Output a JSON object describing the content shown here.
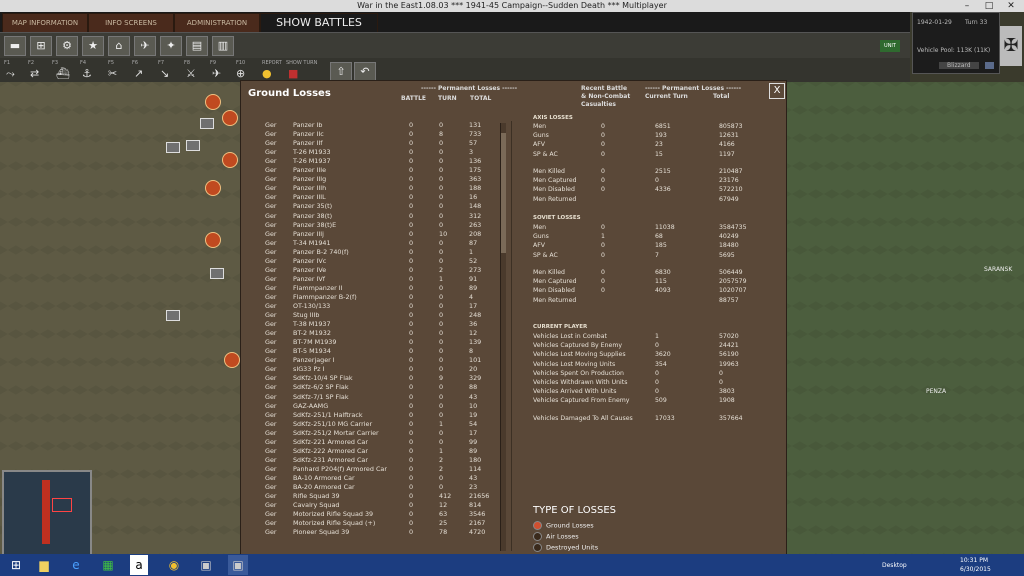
{
  "window": {
    "title": "War in the East1.08.03   ***   1941-45 Campaign--Sudden Death   ***   Multiplayer",
    "controls": [
      "–",
      "□",
      "✕"
    ]
  },
  "tabs": [
    {
      "label": "MAP INFORMATION"
    },
    {
      "label": "INFO SCREENS"
    },
    {
      "label": "ADMINISTRATION"
    },
    {
      "label": "SHOW BATTLES"
    }
  ],
  "infobox": {
    "date": "1942-01-29",
    "turn": "Turn 33",
    "vehicle_pool": "Vehicle Pool: 113K (11K)",
    "weather": "Blizzard",
    "button": "UNIT"
  },
  "fkeys": [
    "F1",
    "F2",
    "F3",
    "F4",
    "F5",
    "F6",
    "F7",
    "F8",
    "F9",
    "F10",
    "REPORT",
    "SHOW TURN"
  ],
  "map_labels": [
    {
      "text": "SARANSK"
    },
    {
      "text": "PENZA"
    }
  ],
  "panel": {
    "title": "Ground Losses",
    "close": "X",
    "headers": {
      "perm": "------ Permanent Losses ------",
      "battle": "BATTLE",
      "turn": "TURN",
      "total": "TOTAL",
      "recent": "Recent Battle",
      "noncombat1": "& Non-Combat",
      "noncombat2": "Casualties",
      "perm2": "------ Permanent Losses ------",
      "current": "Current Turn",
      "total2": "Total"
    },
    "rows": [
      [
        "Ger",
        "Panzer Ib",
        "0",
        "0",
        "131"
      ],
      [
        "Ger",
        "Panzer IIc",
        "0",
        "8",
        "733"
      ],
      [
        "Ger",
        "Panzer IIf",
        "0",
        "0",
        "57"
      ],
      [
        "Ger",
        "T-26 M1933",
        "0",
        "0",
        "3"
      ],
      [
        "Ger",
        "T-26 M1937",
        "0",
        "0",
        "136"
      ],
      [
        "Ger",
        "Panzer IIIe",
        "0",
        "0",
        "175"
      ],
      [
        "Ger",
        "Panzer IIIg",
        "0",
        "0",
        "363"
      ],
      [
        "Ger",
        "Panzer IIIh",
        "0",
        "0",
        "188"
      ],
      [
        "Ger",
        "Panzer IIIL",
        "0",
        "0",
        "16"
      ],
      [
        "Ger",
        "Panzer 35(t)",
        "0",
        "0",
        "148"
      ],
      [
        "Ger",
        "Panzer 38(t)",
        "0",
        "0",
        "312"
      ],
      [
        "Ger",
        "Panzer 38(t)E",
        "0",
        "0",
        "263"
      ],
      [
        "Ger",
        "Panzer IIIj",
        "0",
        "10",
        "208"
      ],
      [
        "Ger",
        "T-34 M1941",
        "0",
        "0",
        "87"
      ],
      [
        "Ger",
        "Panzer B-2 740(f)",
        "0",
        "0",
        "1"
      ],
      [
        "Ger",
        "Panzer IVc",
        "0",
        "0",
        "52"
      ],
      [
        "Ger",
        "Panzer IVe",
        "0",
        "2",
        "273"
      ],
      [
        "Ger",
        "Panzer IVf",
        "0",
        "1",
        "91"
      ],
      [
        "Ger",
        "Flammpanzer II",
        "0",
        "0",
        "89"
      ],
      [
        "Ger",
        "Flammpanzer B-2(f)",
        "0",
        "0",
        "4"
      ],
      [
        "Ger",
        "OT-130/133",
        "0",
        "0",
        "17"
      ],
      [
        "Ger",
        "Stug IIIb",
        "0",
        "0",
        "248"
      ],
      [
        "Ger",
        "T-38 M1937",
        "0",
        "0",
        "36"
      ],
      [
        "Ger",
        "BT-2 M1932",
        "0",
        "0",
        "12"
      ],
      [
        "Ger",
        "BT-7M M1939",
        "0",
        "0",
        "139"
      ],
      [
        "Ger",
        "BT-5 M1934",
        "0",
        "0",
        "8"
      ],
      [
        "Ger",
        "Panzerjager I",
        "0",
        "0",
        "101"
      ],
      [
        "Ger",
        "sIG33 Pz I",
        "0",
        "0",
        "20"
      ],
      [
        "Ger",
        "SdKfz-10/4 SP Flak",
        "0",
        "9",
        "329"
      ],
      [
        "Ger",
        "SdKfz-6/2 SP Flak",
        "0",
        "0",
        "88"
      ],
      [
        "Ger",
        "SdKfz-7/1 SP Flak",
        "0",
        "0",
        "43"
      ],
      [
        "Ger",
        "GAZ-AAMG",
        "0",
        "0",
        "10"
      ],
      [
        "Ger",
        "SdKfz-251/1 Halftrack",
        "0",
        "0",
        "19"
      ],
      [
        "Ger",
        "SdKfz-251/10 MG Carrier",
        "0",
        "1",
        "54"
      ],
      [
        "Ger",
        "SdKfz-251/2 Mortar Carrier",
        "0",
        "0",
        "17"
      ],
      [
        "Ger",
        "SdKfz-221 Armored Car",
        "0",
        "0",
        "99"
      ],
      [
        "Ger",
        "SdKfz-222 Armored Car",
        "0",
        "1",
        "89"
      ],
      [
        "Ger",
        "SdKfz-231 Armored Car",
        "0",
        "2",
        "180"
      ],
      [
        "Ger",
        "Panhard P204(f) Armored Car",
        "0",
        "2",
        "114"
      ],
      [
        "Ger",
        "BA-10 Armored Car",
        "0",
        "0",
        "43"
      ],
      [
        "Ger",
        "BA-20 Armored Car",
        "0",
        "0",
        "23"
      ],
      [
        "Ger",
        "Rifle Squad 39",
        "0",
        "412",
        "21656"
      ],
      [
        "Ger",
        "Cavalry Squad",
        "0",
        "12",
        "814"
      ],
      [
        "Ger",
        "Motorized Rifle Squad 39",
        "0",
        "63",
        "3546"
      ],
      [
        "Ger",
        "Motorized Rifle Squad (+)",
        "0",
        "25",
        "2167"
      ],
      [
        "Ger",
        "Pioneer Squad 39",
        "0",
        "78",
        "4720"
      ]
    ],
    "axis_title": "AXIS LOSSES",
    "axis": [
      [
        "Men",
        "0",
        "6851",
        "805873"
      ],
      [
        "Guns",
        "0",
        "193",
        "12631"
      ],
      [
        "AFV",
        "0",
        "23",
        "4166"
      ],
      [
        "SP & AC",
        "0",
        "15",
        "1197"
      ]
    ],
    "axis2": [
      [
        "Men Killed",
        "0",
        "2515",
        "210487"
      ],
      [
        "Men Captured",
        "0",
        "0",
        "23176"
      ],
      [
        "Men Disabled",
        "0",
        "4336",
        "572210"
      ],
      [
        "Men Returned",
        "",
        "",
        "67949"
      ]
    ],
    "soviet_title": "SOVIET LOSSES",
    "soviet": [
      [
        "Men",
        "0",
        "11038",
        "3584735"
      ],
      [
        "Guns",
        "1",
        "68",
        "40249"
      ],
      [
        "AFV",
        "0",
        "185",
        "18480"
      ],
      [
        "SP & AC",
        "0",
        "7",
        "5695"
      ]
    ],
    "soviet2": [
      [
        "Men Killed",
        "0",
        "6830",
        "506449"
      ],
      [
        "Men Captured",
        "0",
        "115",
        "2057579"
      ],
      [
        "Men Disabled",
        "0",
        "4093",
        "1020707"
      ],
      [
        "Men Returned",
        "",
        "",
        "88757"
      ]
    ],
    "player_title": "CURRENT PLAYER",
    "player": [
      [
        "Vehicles Lost in Combat",
        "1",
        "57020"
      ],
      [
        "Vehicles Captured By Enemy",
        "0",
        "24421"
      ],
      [
        "Vehicles Lost Moving Supplies",
        "3620",
        "56190"
      ],
      [
        "Vehicles Lost Moving Units",
        "354",
        "19963"
      ],
      [
        "Vehicles Spent On Production",
        "0",
        "0"
      ],
      [
        "Vehicles Withdrawn With Units",
        "0",
        "0"
      ],
      [
        "Vehicles Arrived With Units",
        "0",
        "3803"
      ],
      [
        "Vehicles Captured From Enemy",
        "509",
        "1908"
      ]
    ],
    "damaged": [
      "Vehicles Damaged To All Causes",
      "17033",
      "357664"
    ],
    "type_title": "TYPE OF LOSSES",
    "types": [
      "Ground Losses",
      "Air Losses",
      "Destroyed Units"
    ]
  },
  "taskbar": {
    "desktop": "Desktop",
    "time": "10:31 PM",
    "date": "6/30/2015"
  }
}
